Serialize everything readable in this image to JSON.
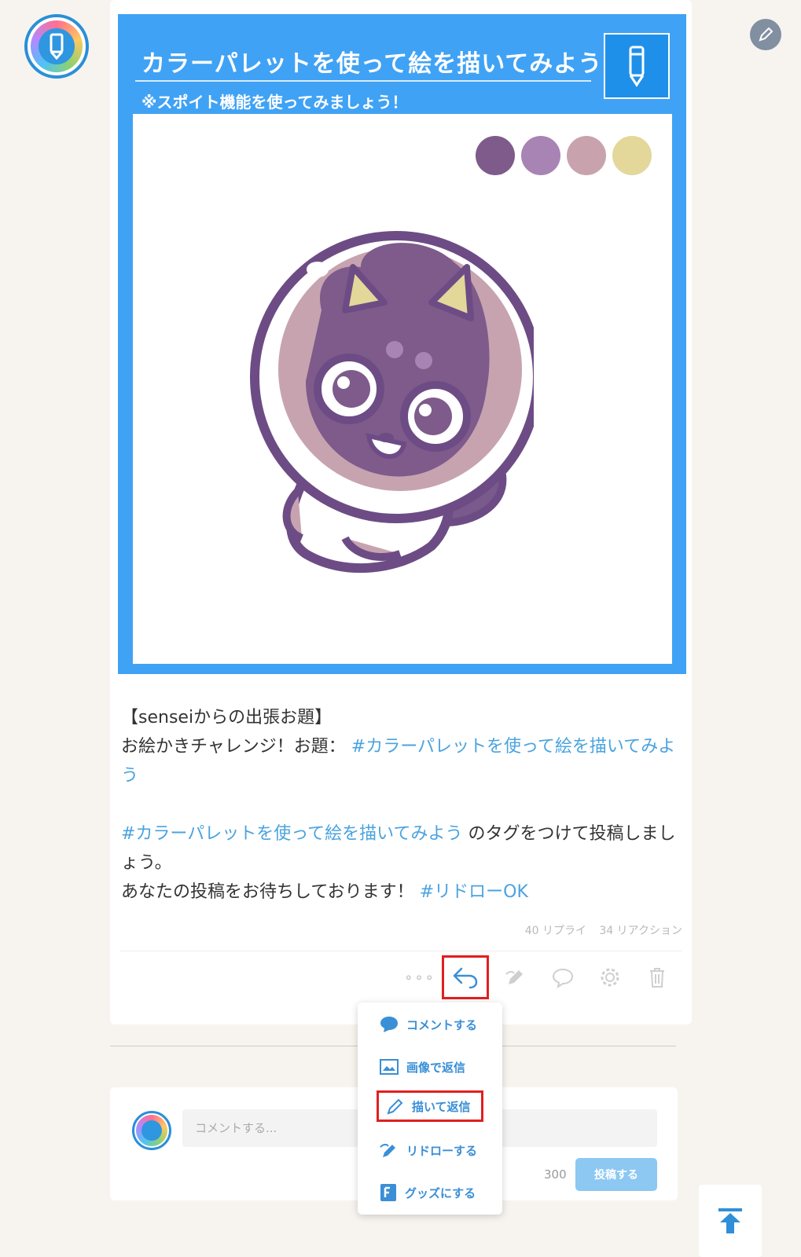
{
  "post": {
    "theme_title": "カラーパレットを使って絵を描いてみよう",
    "theme_subtitle": "※スポイト機能を使ってみましょう！",
    "palette": [
      "#7e5b8b",
      "#a884b4",
      "#c8a3ad",
      "#e3d79a"
    ],
    "text": {
      "line1_a": "【sensei",
      "line1_b": "からの出張お題】",
      "line2_prefix": "お絵かきチャレンジ！お題：",
      "line2_tag": "#カラーパレットを使って絵を描いてみよう",
      "line4_tag": "#カラーパレットを使って絵を描いてみよう",
      "line4_suffix": " のタグをつけて投稿しましょう。",
      "line5_prefix": "あなたの投稿をお待ちしております！",
      "line5_tag": "#リドローOK"
    },
    "counts": {
      "replies": "40 リプライ",
      "reactions": "34 リアクション"
    },
    "more_label": "∘∘∘"
  },
  "reply_menu": {
    "items": [
      {
        "label": "コメントする",
        "icon": "comment-bubble-icon"
      },
      {
        "label": "画像で返信",
        "icon": "image-icon"
      },
      {
        "label": "描いて返信",
        "icon": "pencil-icon"
      },
      {
        "label": "リドローする",
        "icon": "redraw-icon"
      },
      {
        "label": "グッズにする",
        "icon": "goods-icon"
      }
    ]
  },
  "comment_form": {
    "placeholder": "コメントする...",
    "char_count": "300",
    "submit_label": "投稿する"
  },
  "colors": {
    "accent": "#40a2f4",
    "link": "#4aa3df",
    "highlight_box": "#e0201f"
  }
}
